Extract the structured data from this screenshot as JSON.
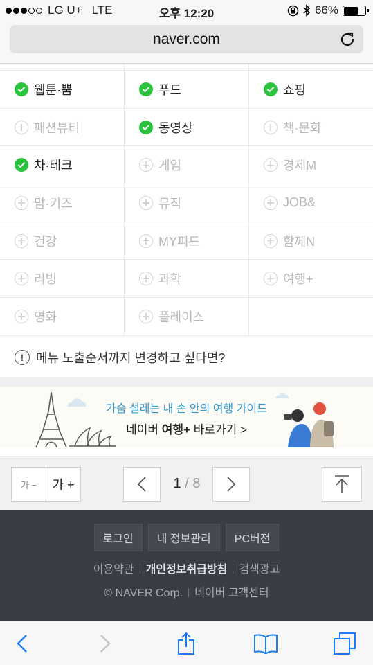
{
  "status_bar": {
    "carrier": "LG U+",
    "network": "LTE",
    "time": "오후 12:20",
    "battery_percent": "66%",
    "battery_level": 0.66
  },
  "url_bar": {
    "url": "naver.com"
  },
  "topics": [
    [
      {
        "label": "웹툰·뿜",
        "subscribed": true
      },
      {
        "label": "푸드",
        "subscribed": true
      },
      {
        "label": "쇼핑",
        "subscribed": true
      }
    ],
    [
      {
        "label": "패션뷰티",
        "subscribed": false
      },
      {
        "label": "동영상",
        "subscribed": true
      },
      {
        "label": "책·문화",
        "subscribed": false
      }
    ],
    [
      {
        "label": "차·테크",
        "subscribed": true
      },
      {
        "label": "게임",
        "subscribed": false
      },
      {
        "label": "경제M",
        "subscribed": false
      }
    ],
    [
      {
        "label": "맘·키즈",
        "subscribed": false
      },
      {
        "label": "뮤직",
        "subscribed": false
      },
      {
        "label": "JOB&",
        "subscribed": false
      }
    ],
    [
      {
        "label": "건강",
        "subscribed": false
      },
      {
        "label": "MY피드",
        "subscribed": false
      },
      {
        "label": "함께N",
        "subscribed": false
      }
    ],
    [
      {
        "label": "리빙",
        "subscribed": false
      },
      {
        "label": "과학",
        "subscribed": false
      },
      {
        "label": "여행+",
        "subscribed": false
      }
    ],
    [
      {
        "label": "영화",
        "subscribed": false
      },
      {
        "label": "플레이스",
        "subscribed": false
      },
      null
    ]
  ],
  "notice": {
    "text": "메뉴 노출순서까지 변경하고 싶다면?"
  },
  "banner": {
    "line1": "가슴 설레는 내 손 안의 여행 가이드",
    "line2_prefix": "네이버 ",
    "line2_bold": "여행+",
    "line2_suffix": " 바로가기 >"
  },
  "pager": {
    "font_smaller": "가 −",
    "font_larger": "가 +",
    "current_page": "1",
    "separator": "/",
    "total_pages": "8"
  },
  "footer": {
    "buttons": [
      "로그인",
      "내 정보관리",
      "PC버전"
    ],
    "links": [
      "이용약관",
      "개인정보취급방침",
      "검색광고"
    ],
    "copyright": "© NAVER Corp.",
    "customer_center": "네이버 고객센터"
  },
  "colors": {
    "check_green": "#2bc23d",
    "banner_blue": "#2f9bd6",
    "footer_bg": "#3a3d45",
    "safari_blue": "#1a7cf6"
  }
}
